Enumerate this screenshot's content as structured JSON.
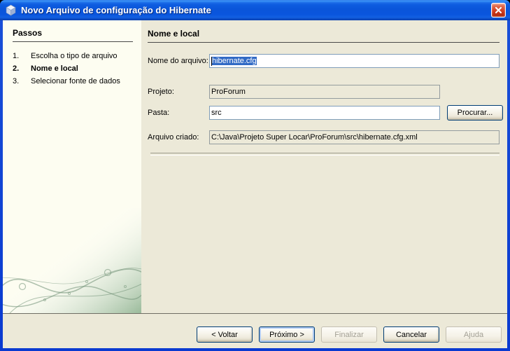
{
  "window": {
    "title": "Novo Arquivo de configuração do Hibernate",
    "icon": "new-file-cube-icon",
    "close_icon": "close-x-icon"
  },
  "steps_panel": {
    "title": "Passos",
    "items": [
      {
        "number": "1.",
        "label": "Escolha o tipo de arquivo",
        "current": false
      },
      {
        "number": "2.",
        "label": "Nome e local",
        "current": true
      },
      {
        "number": "3.",
        "label": "Selecionar fonte de dados",
        "current": false
      }
    ]
  },
  "main": {
    "title": "Nome e local",
    "fields": {
      "file_name": {
        "label": "Nome do arquivo:",
        "value": "hibernate.cfg",
        "selected": true
      },
      "project": {
        "label": "Projeto:",
        "value": "ProForum",
        "readonly": true
      },
      "folder": {
        "label": "Pasta:",
        "value": "src"
      },
      "browse_label": "Procurar...",
      "created_file": {
        "label": "Arquivo criado:",
        "value": "C:\\Java\\Projeto Super Locar\\ProForum\\src\\hibernate.cfg.xml",
        "readonly": true
      }
    }
  },
  "footer": {
    "buttons": [
      {
        "label": "< Voltar",
        "state": "enabled"
      },
      {
        "label": "Próximo >",
        "state": "focused"
      },
      {
        "label": "Finalizar",
        "state": "disabled"
      },
      {
        "label": "Cancelar",
        "state": "enabled"
      },
      {
        "label": "Ajuda",
        "state": "disabled"
      }
    ]
  },
  "colors": {
    "titlebar_blue": "#0a55dd",
    "frame_blue": "#0a3ad0",
    "panel_beige": "#ece9d8",
    "sidebar_cream": "#fdfdf1",
    "selection_blue": "#316ac5",
    "field_border": "#7f9db9",
    "close_red": "#d34325",
    "watermark_green": "#8fb391"
  }
}
